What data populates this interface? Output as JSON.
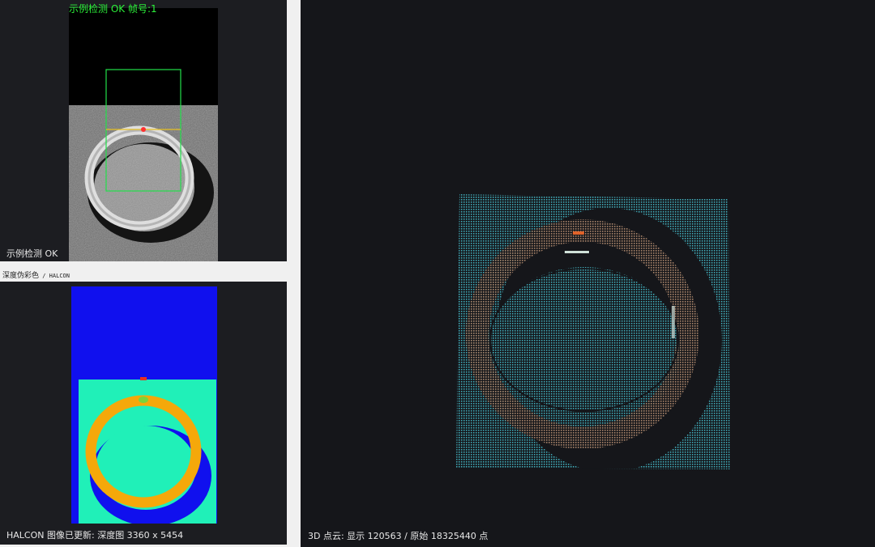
{
  "top_view": {
    "status_title": "示例检测 OK  帧号:1",
    "bottom_label": "示例检测 OK"
  },
  "depth_view": {
    "header_label": "深度伪彩色",
    "header_separator": " / ",
    "header_engine": "HALCON",
    "bottom_label": "HALCON 图像已更新: 深度图  3360 x 5454"
  },
  "cloud_view": {
    "bottom_label": "3D 点云: 显示 120563 / 原始 18325440 点"
  },
  "colors": {
    "ok_green": "#2cf23a",
    "roi_box": "#22e04a",
    "measure_line": "#e8c020",
    "marker_red": "#ff3030",
    "depth_blue": "#1010ee",
    "depth_cyan": "#20f0b8",
    "depth_orange": "#f5a80a",
    "cloud_teal": "#3a9eab",
    "cloud_ring": "#8a6a55"
  }
}
